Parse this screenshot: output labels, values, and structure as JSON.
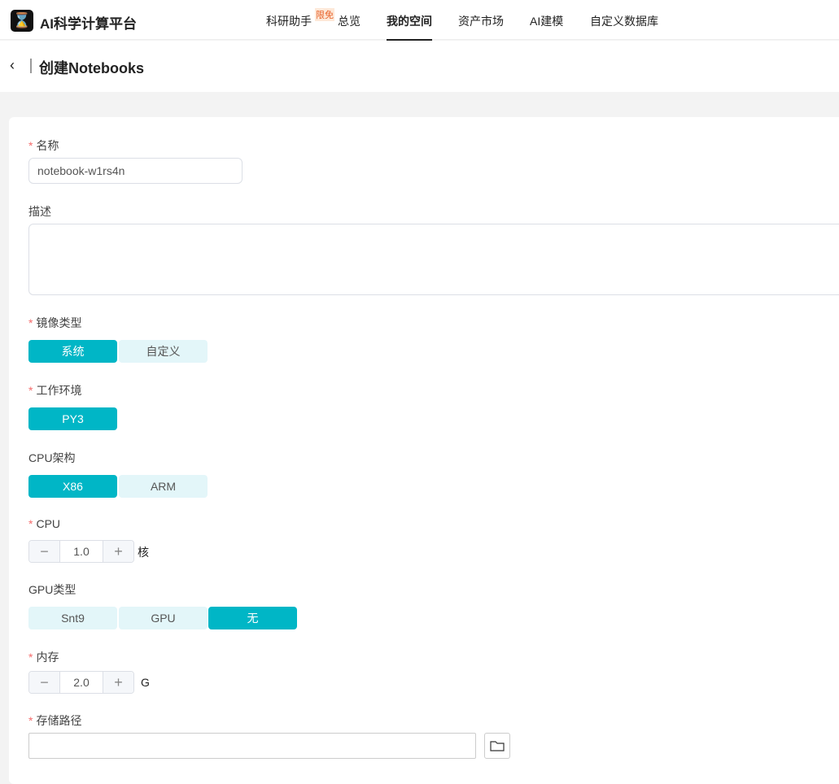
{
  "app": {
    "logo": "⌛",
    "title": "AI科学计算平台"
  },
  "nav": [
    {
      "label": "科研助手"
    },
    {
      "label": "总览"
    },
    {
      "label": "我的空间"
    },
    {
      "label": "资产市场"
    },
    {
      "label": "AI建模"
    },
    {
      "label": "自定义数据库"
    }
  ],
  "nav_badge": "限免",
  "page": {
    "back": "‹",
    "title": "创建Notebooks"
  },
  "form": {
    "req": "*",
    "name_label": "名称",
    "name_value": "notebook-w1rs4n",
    "desc_label": "描述",
    "image_label": "镜像类型",
    "image_options": [
      "系统",
      "自定义"
    ],
    "env_label": "工作环境",
    "env_options": [
      "PY3"
    ],
    "arch_label": "CPU架构",
    "arch_options": [
      "X86",
      "ARM"
    ],
    "cpu_label": "CPU",
    "cpu_value": "1.0",
    "cpu_unit": "核",
    "gpu_label": "GPU类型",
    "gpu_options": [
      "Snt9",
      "GPU",
      "无"
    ],
    "mem_label": "内存",
    "mem_value": "2.0",
    "mem_unit": "G",
    "path_label": "存储路径",
    "path_value": "",
    "minus": "−",
    "plus": "+"
  }
}
